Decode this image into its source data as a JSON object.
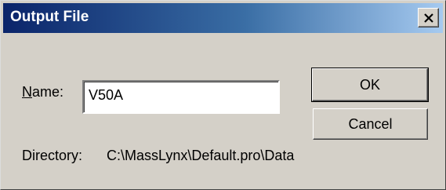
{
  "window": {
    "title": "Output File"
  },
  "form": {
    "name_label_mnemonic": "N",
    "name_label_rest": "ame:",
    "name_value": "V50A",
    "directory_label": "Directory:",
    "directory_value": "C:\\MassLynx\\Default.pro\\Data"
  },
  "buttons": {
    "ok_label": "OK",
    "cancel_label": "Cancel"
  },
  "icons": {
    "close": "close-icon"
  },
  "colors": {
    "titlebar_start": "#0a246a",
    "titlebar_end": "#a6caf0",
    "face": "#d4d0c8"
  }
}
